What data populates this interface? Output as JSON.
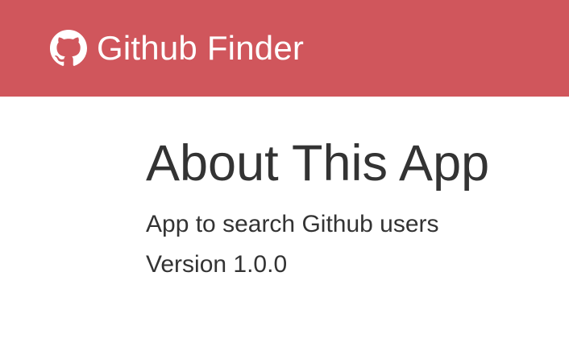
{
  "navbar": {
    "brand_icon": "github-icon",
    "title": "Github Finder",
    "background_color": "#d0565c"
  },
  "about": {
    "title": "About This App",
    "description": "App to search Github users",
    "version": "Version 1.0.0"
  }
}
